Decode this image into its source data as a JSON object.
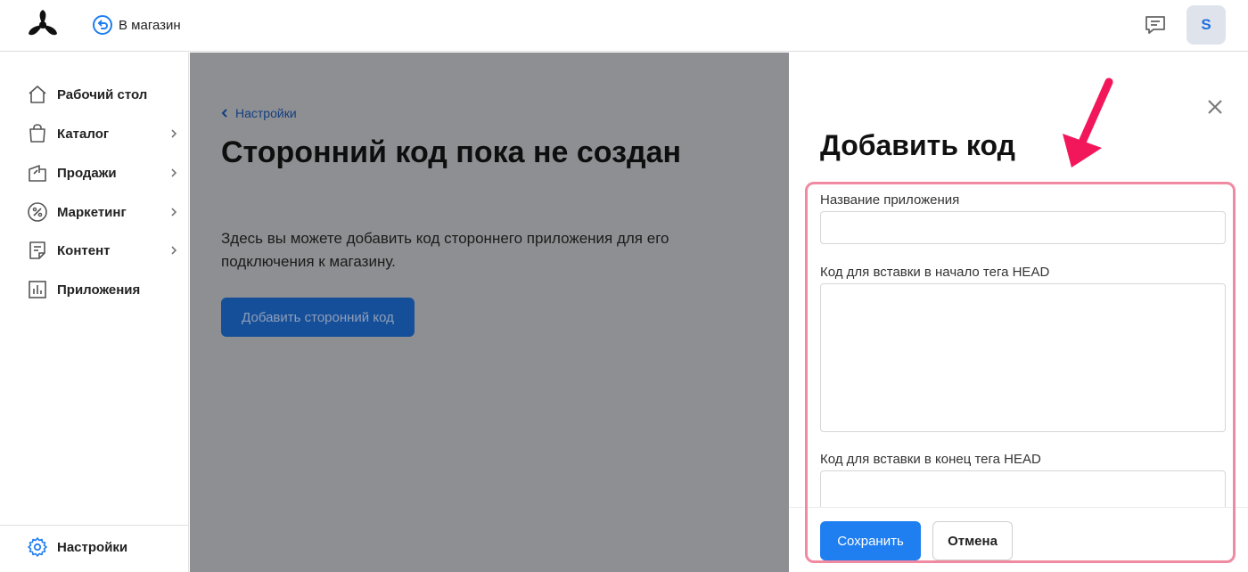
{
  "topbar": {
    "logo_icon": "fan-logo-icon",
    "back_label": "В магазин",
    "back_icon": "circular-arrow-back-icon",
    "chat_icon": "message-icon",
    "avatar_letter": "S",
    "accent": "#1f7ef0"
  },
  "sidebar": {
    "items": [
      {
        "label": "Рабочий стол",
        "icon": "home-icon",
        "has_chevron": false
      },
      {
        "label": "Каталог",
        "icon": "shopping-bag-icon",
        "has_chevron": true
      },
      {
        "label": "Продажи",
        "icon": "sales-icon",
        "has_chevron": true
      },
      {
        "label": "Маркетинг",
        "icon": "percent-icon",
        "has_chevron": true
      },
      {
        "label": "Контент",
        "icon": "document-icon",
        "has_chevron": true
      },
      {
        "label": "Приложения",
        "icon": "bar-chart-icon",
        "has_chevron": false
      }
    ],
    "settings_label": "Настройки",
    "settings_icon": "gear-icon"
  },
  "main": {
    "breadcrumb": "Настройки",
    "title": "Сторонний код пока не создан",
    "description": "Здесь вы можете добавить код стороннего приложения для его подключения к магазину.",
    "add_button": "Добавить сторонний код"
  },
  "drawer": {
    "title": "Добавить код",
    "fields": {
      "app_name_label": "Название приложения",
      "app_name_value": "",
      "head_start_label": "Код для вставки в начало тега HEAD",
      "head_start_value": "",
      "head_end_label": "Код для вставки в конец тега HEAD",
      "head_end_value": ""
    },
    "save_button": "Сохранить",
    "cancel_button": "Отмена",
    "close_icon": "close-icon"
  },
  "annotation": {
    "highlight_color": "#f08aa3",
    "arrow_color": "#f2175a"
  }
}
